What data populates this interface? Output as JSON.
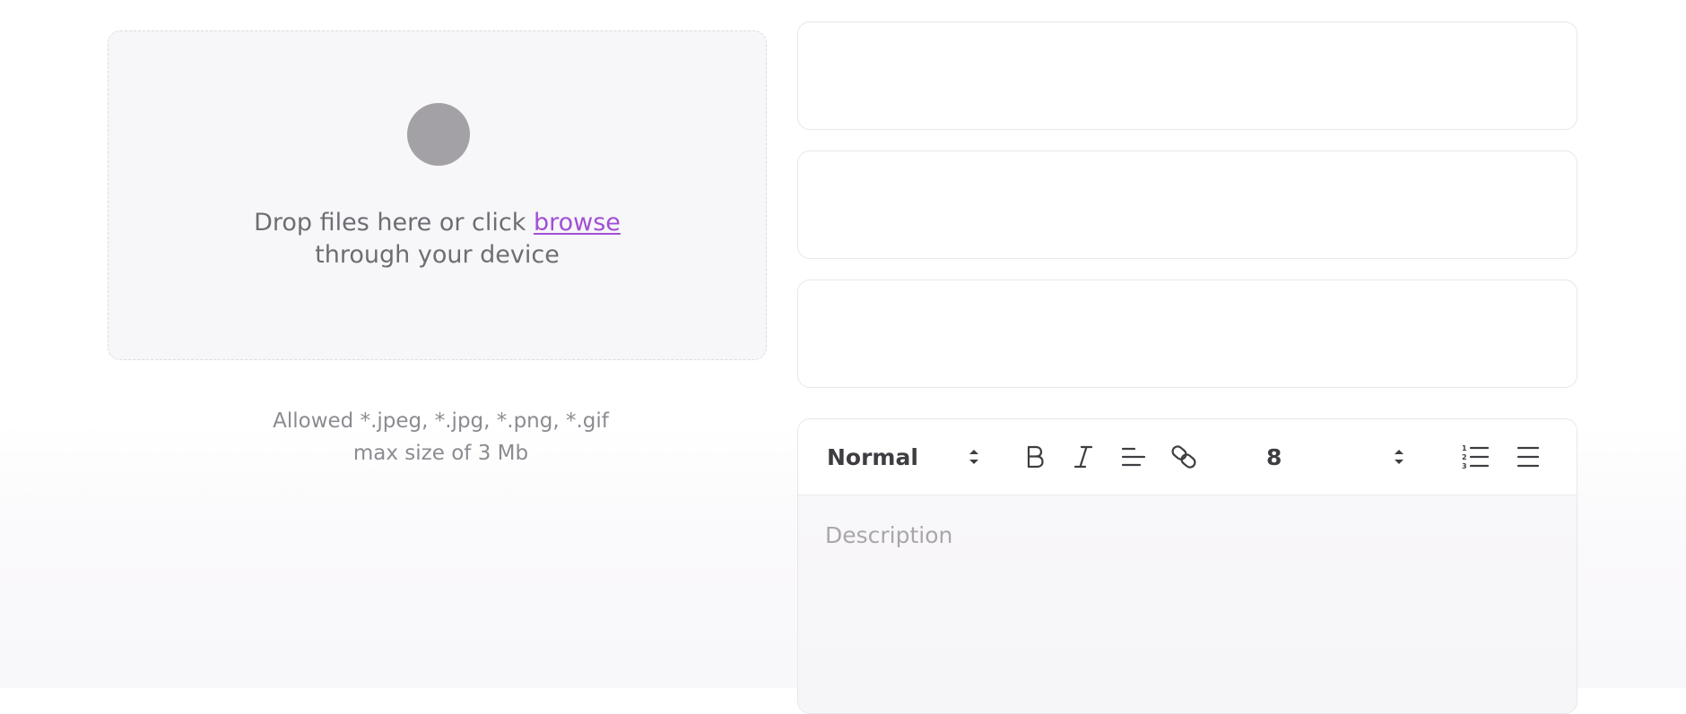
{
  "upload": {
    "prompt_prefix": "Drop files here or click ",
    "browse_link": "browse",
    "prompt_suffix": "through your device",
    "allowed_types": "Allowed *.jpeg, *.jpg, *.png, *.gif",
    "max_size": "max size of 3 Mb",
    "icon": "avatar-placeholder-icon"
  },
  "fields": [
    {
      "value": ""
    },
    {
      "value": ""
    },
    {
      "value": ""
    }
  ],
  "editor": {
    "format_value": "Normal",
    "font_size_value": "8",
    "placeholder": "Description",
    "toolbar_icons": [
      "bold-icon",
      "italic-icon",
      "align-left-icon",
      "link-icon",
      "ordered-list-icon",
      "bullet-list-icon"
    ]
  },
  "colors": {
    "accent": "#a14fd6",
    "dropzone_bg": "#f7f6f8",
    "border": "#e8e6ea",
    "text_muted": "#8d8a91",
    "avatar": "#a3a1a6"
  }
}
